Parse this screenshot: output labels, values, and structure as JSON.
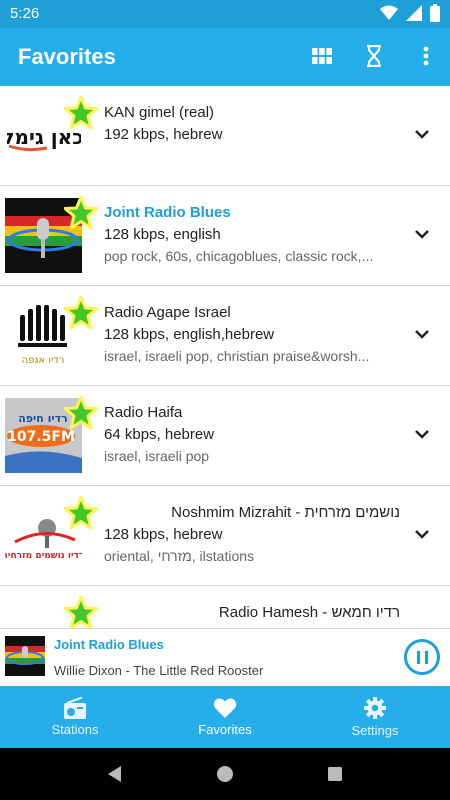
{
  "status_bar": {
    "time": "5:26"
  },
  "app_bar": {
    "title": "Favorites",
    "icons": [
      "grid-icon",
      "hourglass-icon",
      "more-vert-icon"
    ]
  },
  "stations": [
    {
      "name": "KAN gimel (real)",
      "bitrate": "192 kbps, hebrew",
      "tags": "",
      "rtl": false,
      "active": false,
      "logo": "kan-gimel-logo"
    },
    {
      "name": "Joint Radio Blues",
      "bitrate": "128 kbps, english",
      "tags": "pop rock, 60s, chicagoblues, classic rock,...",
      "rtl": false,
      "active": true,
      "logo": "joint-radio-logo"
    },
    {
      "name": "Radio Agape Israel",
      "bitrate": "128 kbps, english,hebrew",
      "tags": "israel, israeli pop, christian praise&worsh...",
      "rtl": false,
      "active": false,
      "logo": "agape-logo"
    },
    {
      "name": "Radio Haifa",
      "bitrate": "64 kbps, hebrew",
      "tags": "israel, israeli pop",
      "rtl": false,
      "active": false,
      "logo": "haifa-logo"
    },
    {
      "name": "Noshmim Mizrahit - נושמים מזרחית",
      "bitrate": "128 kbps, hebrew",
      "tags": "oriental, מזרחי, ilstations",
      "rtl": true,
      "active": false,
      "logo": "noshmim-logo"
    },
    {
      "name": "Radio Hamesh - רדיו חמאש",
      "bitrate": "",
      "tags": "",
      "rtl": true,
      "active": false,
      "logo": "hamesh-logo"
    }
  ],
  "now_playing": {
    "title": "Joint Radio Blues",
    "track": "Willie Dixon - The Little Red Rooster"
  },
  "bottom_nav": [
    {
      "label": "Stations",
      "icon": "radio-icon"
    },
    {
      "label": "Favorites",
      "icon": "heart-icon"
    },
    {
      "label": "Settings",
      "icon": "gear-icon"
    }
  ],
  "logo_text": {
    "kan": "כאן גימל",
    "agape": "רדיו אגפה",
    "haifa_brand": "רדיו חיפה",
    "haifa_freq": "107.5FM",
    "noshmim": "רדיו נושמים מזרחית"
  },
  "colors": {
    "primary": "#25aeea",
    "primary_dark": "#1e9fd8",
    "accent_star": "#44c72b"
  }
}
